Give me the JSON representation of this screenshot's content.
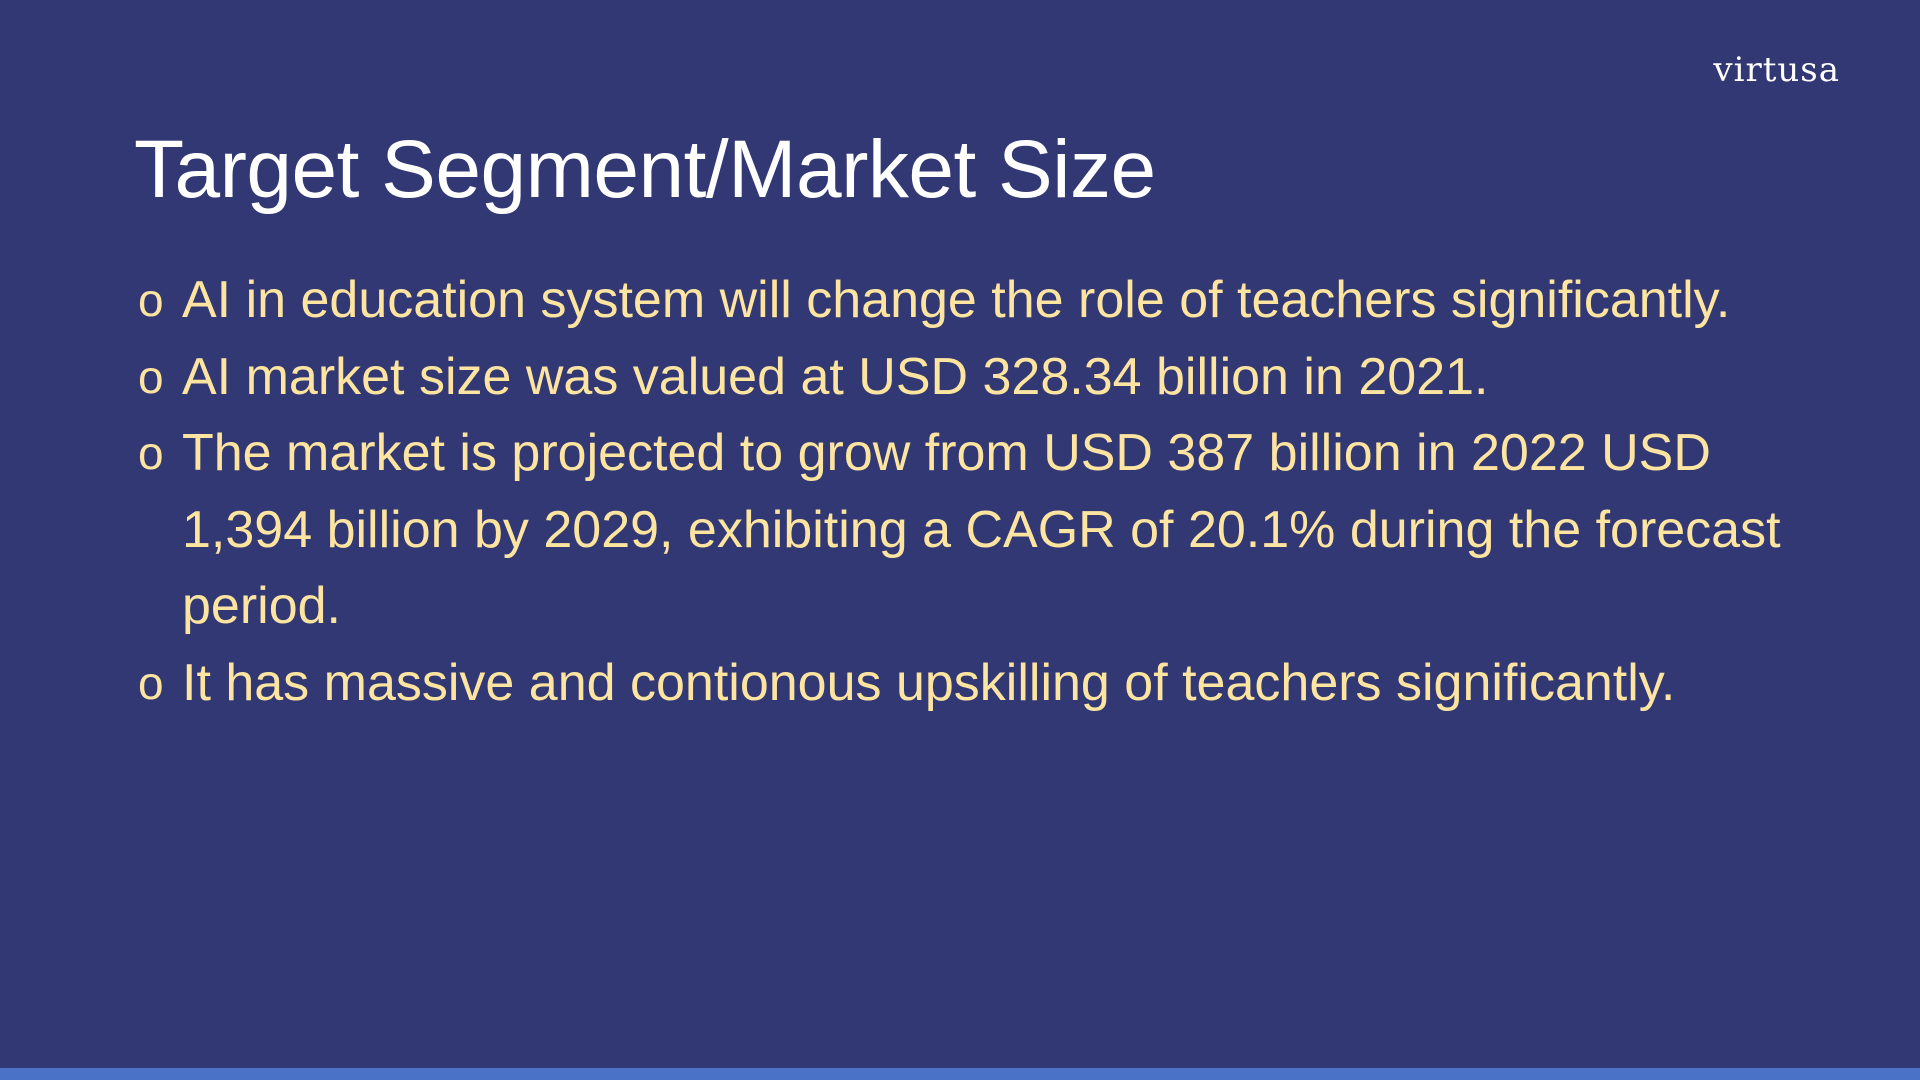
{
  "slide": {
    "logo_text": "virtusa",
    "title": "Target Segment/Market Size",
    "bullet_marker": "o",
    "bullets": [
      "AI in education system will change the role of teachers significantly.",
      "AI market size  was valued at USD 328.34 billion in 2021.",
      "The market is projected to grow from USD 387 billion in 2022 USD 1,394 billion by 2029, exhibiting  a CAGR of 20.1% during the forecast period.",
      "It has massive and contionous upskilling of teachers significantly."
    ]
  },
  "colors": {
    "background": "#323873",
    "title_text": "#ffffff",
    "bullet_text": "#fde5a1",
    "bottom_bar": "#4a73c8"
  }
}
